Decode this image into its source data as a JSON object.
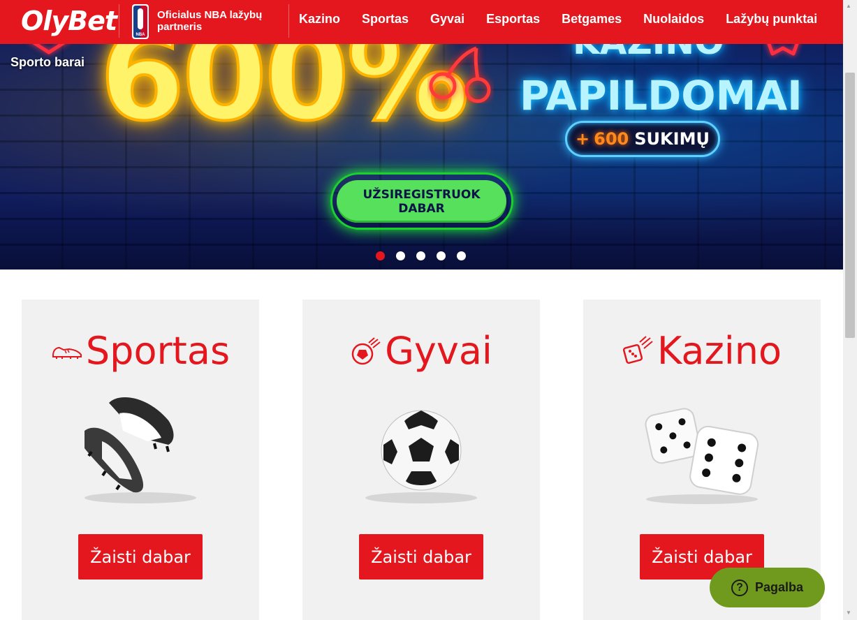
{
  "header": {
    "logo": "OlyBet",
    "partner_text": "Oficialus NBA lažybų partneris",
    "nba_badge": "NBA",
    "nav": [
      "Kazino",
      "Sportas",
      "Gyvai",
      "Esportas",
      "Betgames",
      "Nuolaidos",
      "Lažybų punktai"
    ]
  },
  "hero": {
    "side_link": "Sporto barai",
    "percent": "600%",
    "line1": "KAZINO",
    "line2": "PAPILDOMAI",
    "spins_plus": "+",
    "spins_number": "600",
    "spins_word": "SUKIMŲ",
    "cta": "UŽSIREGISTRUOK DABAR",
    "slides_total": 5,
    "active_slide": 1
  },
  "cards": [
    {
      "title": "Sportas",
      "icon": "football-boot-icon",
      "image": "football-boots",
      "button": "Žaisti dabar"
    },
    {
      "title": "Gyvai",
      "icon": "live-ball-icon",
      "image": "soccer-ball",
      "button": "Žaisti dabar"
    },
    {
      "title": "Kazino",
      "icon": "dice-icon",
      "image": "dice",
      "button": "Žaisti dabar"
    }
  ],
  "help": {
    "label": "Pagalba",
    "icon": "question-icon"
  },
  "colors": {
    "brand_red": "#e3171d",
    "cta_green": "#57e05b",
    "help_green": "#6f9a1d",
    "card_bg": "#f1f1f1"
  }
}
